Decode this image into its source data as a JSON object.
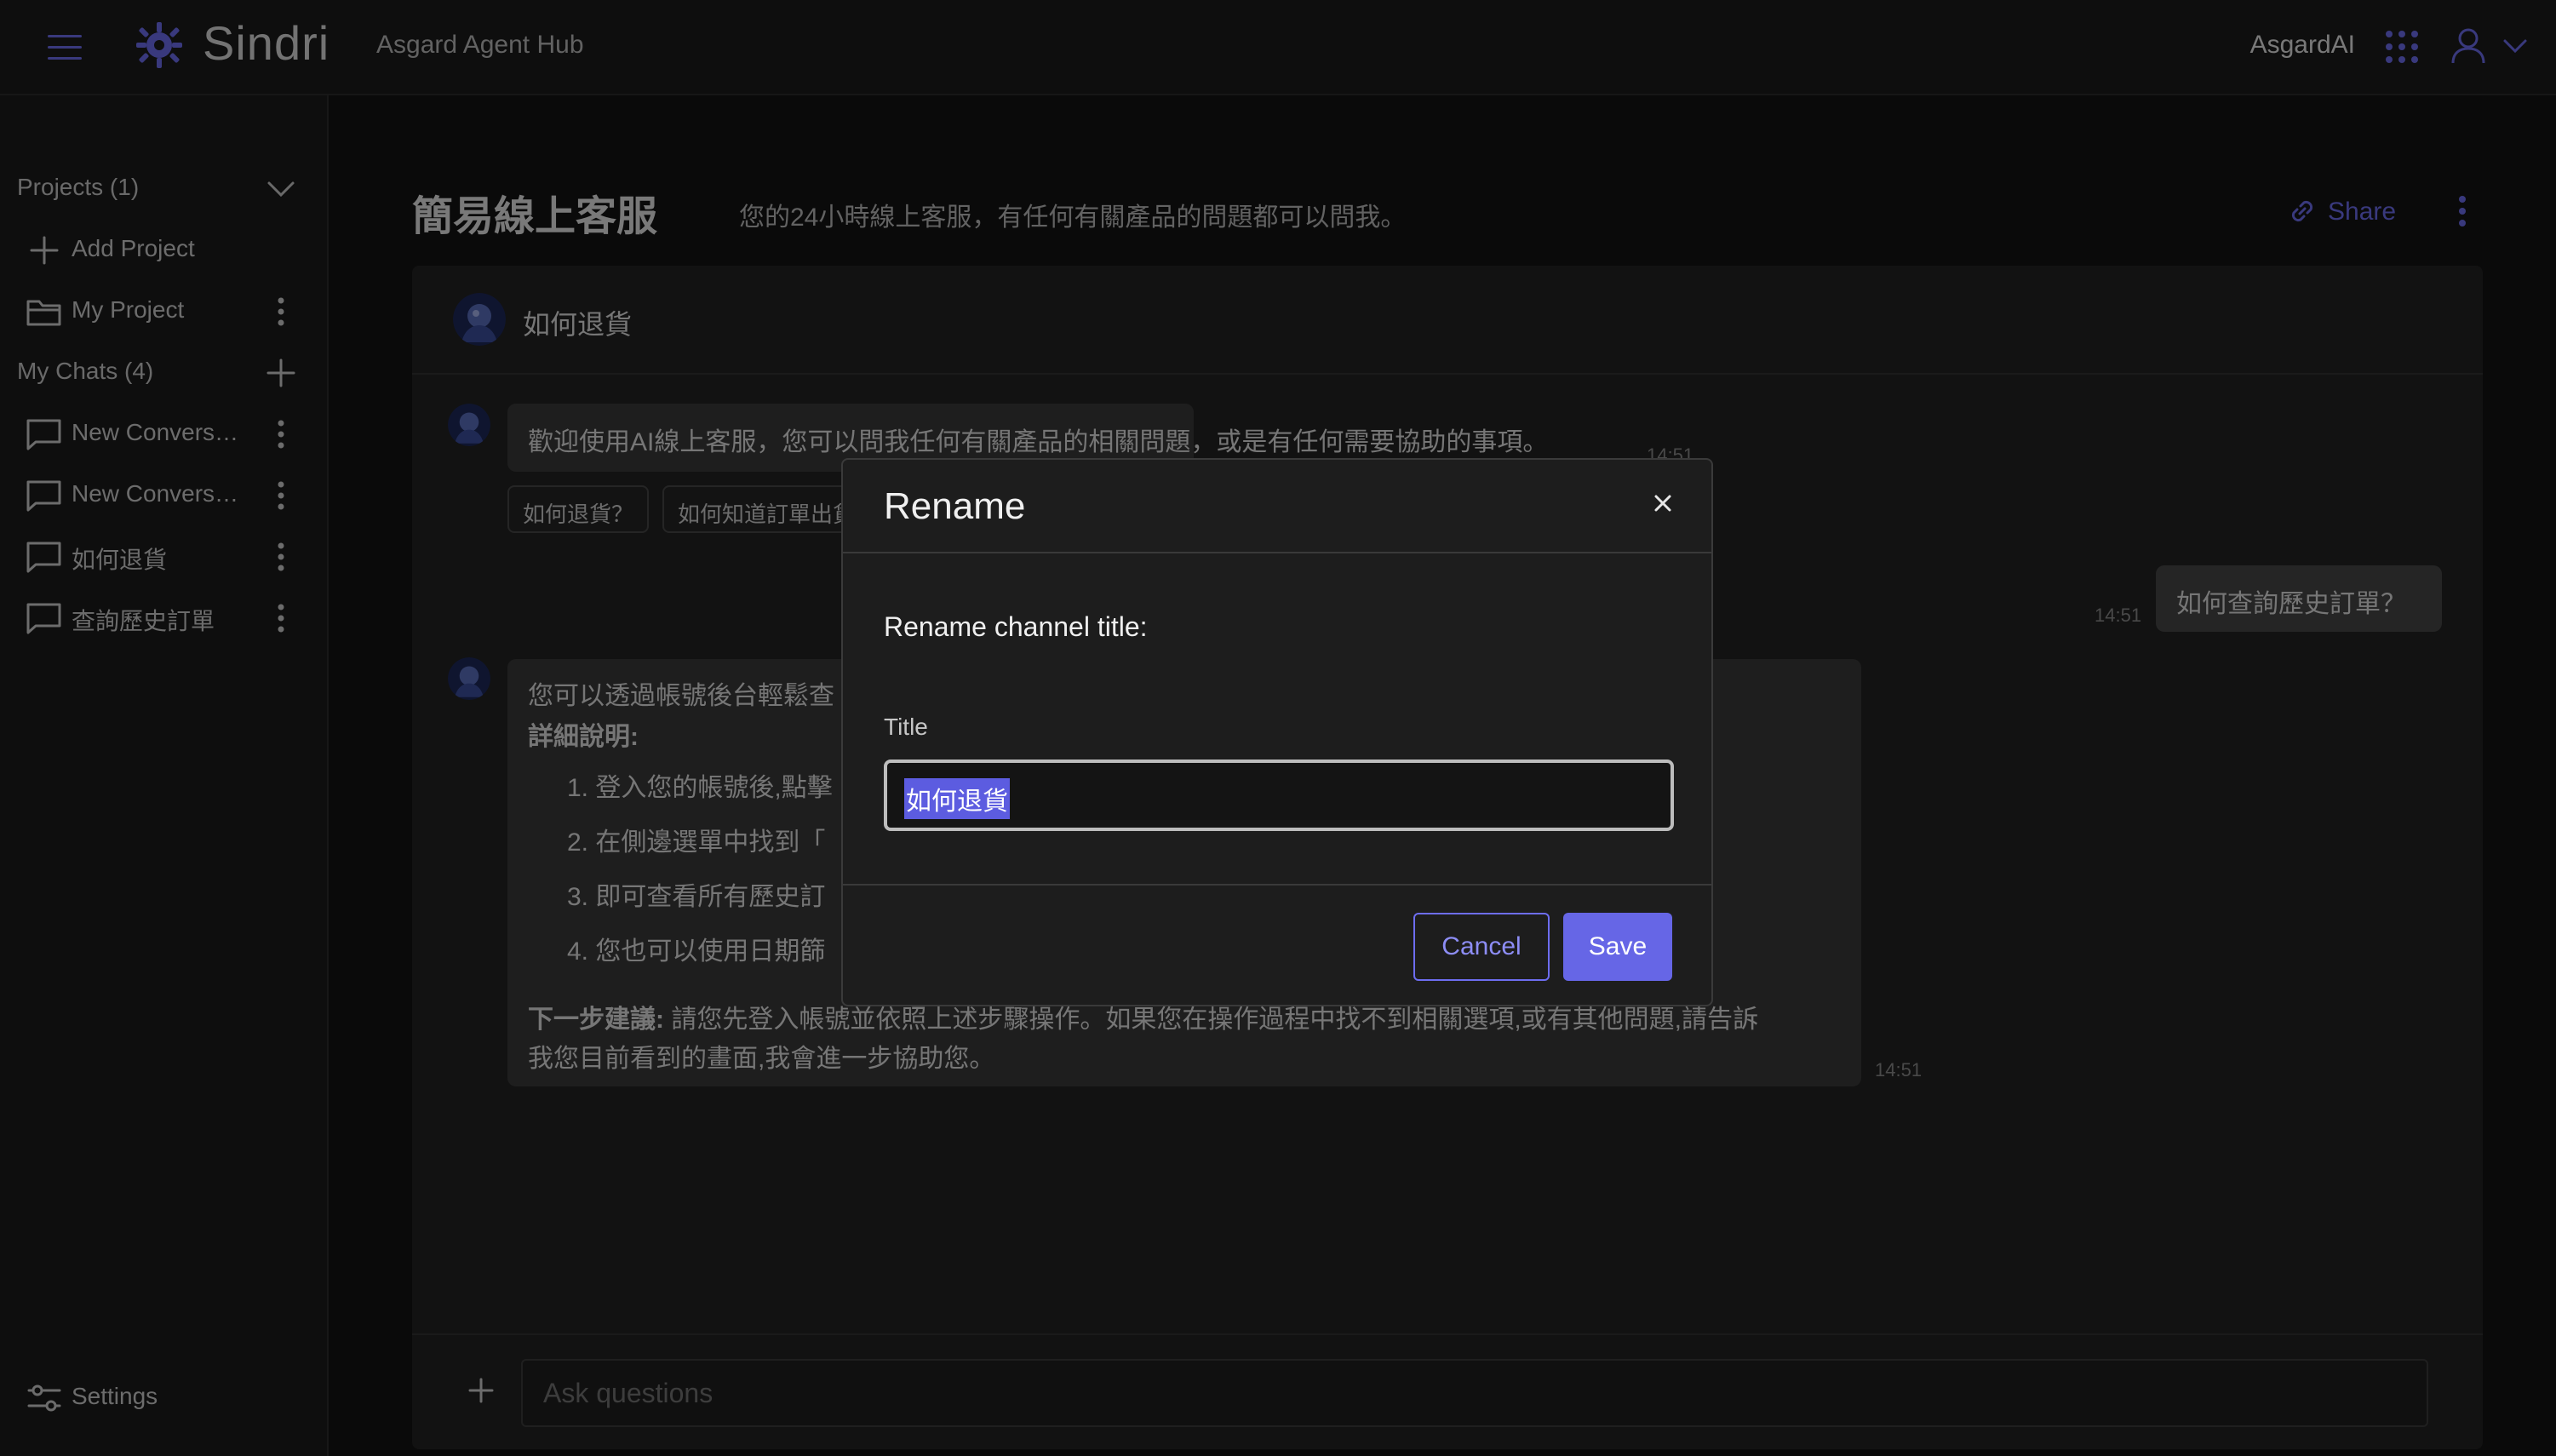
{
  "header": {
    "brand": "Sindri",
    "hub_title": "Asgard Agent Hub",
    "org_name": "AsgardAI",
    "accent_color": "#6d6df0"
  },
  "sidebar": {
    "projects_label": "Projects (1)",
    "add_project_label": "Add Project",
    "project_items": [
      {
        "label": "My Project",
        "icon": "folder-icon"
      }
    ],
    "chats_label": "My Chats (4)",
    "chat_items": [
      {
        "label": "New Convers…",
        "icon": "chat-bubble-icon"
      },
      {
        "label": "New Convers…",
        "icon": "chat-bubble-icon"
      },
      {
        "label": "如何退貨",
        "icon": "chat-bubble-icon"
      },
      {
        "label": "查詢歷史訂單",
        "icon": "chat-bubble-icon"
      }
    ],
    "settings_label": "Settings"
  },
  "main": {
    "title": "簡易線上客服",
    "description": "您的24小時線上客服，有任何有關產品的問題都可以問我。",
    "share_label": "Share",
    "chat_title": "如何退貨",
    "messages": {
      "welcome": "歡迎使用AI線上客服，您可以問我任何有關產品的相關問題，或是有任何需要協助的事項。",
      "welcome_time": "14:51",
      "suggestions": [
        "如何退貨？",
        "如何知道訂單出貨"
      ],
      "user_question": "如何查詢歷史訂單？",
      "user_time": "14:51",
      "answer_intro": "您可以透過帳號後台輕鬆查",
      "answer_heading": "詳細說明:",
      "answer_steps": [
        "1. 登入您的帳號後,點擊",
        "2. 在側邊選單中找到「",
        "3. 即可查看所有歷史訂",
        "4. 您也可以使用日期篩"
      ],
      "next_label": "下一步建議:",
      "next_text_line1": " 請您先登入帳號並依照上述步驟操作。如果您在操作過程中找不到相關選項,或有其他問題,請告訴",
      "next_text_line2": "我您目前看到的畫面,我會進一步協助您。",
      "answer_time": "14:51"
    },
    "input_placeholder": "Ask questions"
  },
  "modal": {
    "title": "Rename",
    "prompt": "Rename channel title:",
    "field_label": "Title",
    "field_value": "如何退貨",
    "cancel_label": "Cancel",
    "save_label": "Save"
  }
}
